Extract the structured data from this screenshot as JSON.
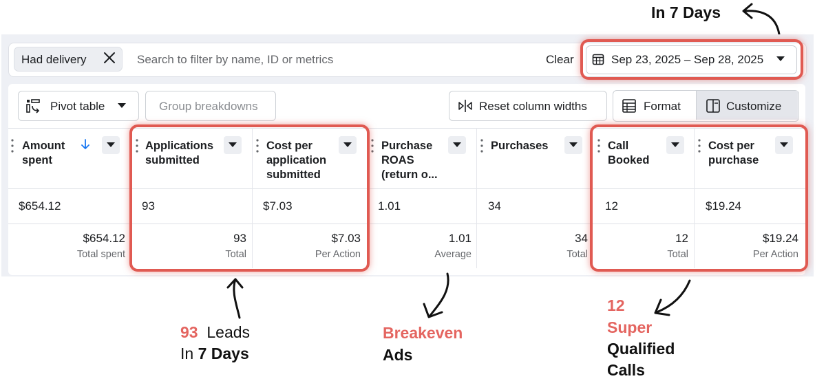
{
  "filter_bar": {
    "chip_label": "Had delivery",
    "search_placeholder": "Search to filter by name, ID or metrics",
    "clear_label": "Clear",
    "date_range": "Sep 23, 2025 – Sep 28, 2025"
  },
  "toolbar": {
    "pivot_label": "Pivot table",
    "group_label": "Group breakdowns",
    "reset_label": "Reset column widths",
    "format_label": "Format",
    "customize_label": "Customize"
  },
  "table": {
    "columns": [
      {
        "h1": "Amount",
        "h2": "spent",
        "h3": "",
        "value": "$654.12",
        "total": "$654.12",
        "total_label": "Total spent"
      },
      {
        "h1": "Applications",
        "h2": "submitted",
        "h3": "",
        "value": "93",
        "total": "93",
        "total_label": "Total"
      },
      {
        "h1": "Cost per",
        "h2": "application",
        "h3": "submitted",
        "value": "$7.03",
        "total": "$7.03",
        "total_label": "Per Action"
      },
      {
        "h1": "Purchase",
        "h2": "ROAS",
        "h3": "(return o...",
        "value": "1.01",
        "total": "1.01",
        "total_label": "Average"
      },
      {
        "h1": "Purchases",
        "h2": "",
        "h3": "",
        "value": "34",
        "total": "34",
        "total_label": "Total"
      },
      {
        "h1": "Call",
        "h2": "Booked",
        "h3": "",
        "value": "12",
        "total": "12",
        "total_label": "Total"
      },
      {
        "h1": "Cost per",
        "h2": "purchase",
        "h3": "",
        "value": "$19.24",
        "total": "$19.24",
        "total_label": "Per Action"
      }
    ]
  },
  "annotations": {
    "top": "In 7 Days",
    "leads_num": "93",
    "leads_word": "Leads",
    "leads_in": "In",
    "leads_days": "7 Days",
    "breakeven": "Breakeven",
    "ads": "Ads",
    "calls_num": "12",
    "calls_super": "Super",
    "calls_qualified": "Qualified",
    "calls_word": "Calls"
  },
  "colors": {
    "highlight": "#e05a52",
    "annotation_red": "#e46560",
    "sort_arrow": "#1877f2"
  },
  "icons": [
    "close-icon",
    "calendar-icon",
    "chevron-down-icon",
    "pivot-table-icon",
    "reset-columns-icon",
    "format-icon",
    "customize-icon",
    "sort-down-icon",
    "drag-handle-icon",
    "curved-arrow-icon"
  ]
}
